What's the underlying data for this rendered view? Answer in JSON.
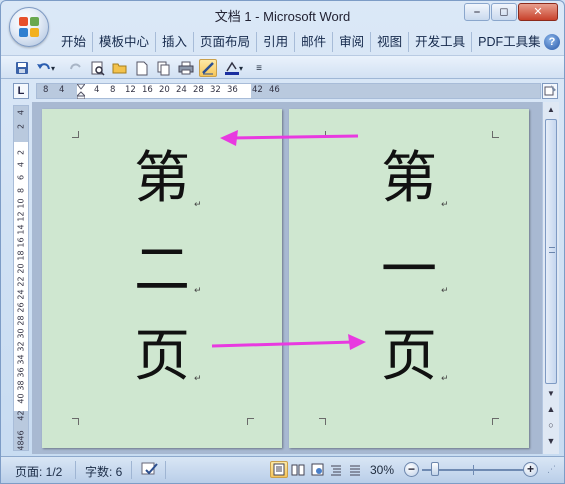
{
  "window": {
    "title": "文档 1 - Microsoft Word",
    "minimize": "⎯",
    "maximize": "◻",
    "close": "✕"
  },
  "ribbon": {
    "tabs": [
      "开始",
      "模板中心",
      "插入",
      "页面布局",
      "引用",
      "邮件",
      "审阅",
      "视图",
      "开发工具",
      "PDF工具集"
    ],
    "help": "?"
  },
  "quick_access": {
    "buttons": [
      "save-icon",
      "undo-icon",
      "redo-icon",
      "print-preview-icon",
      "open-icon",
      "new-icon",
      "copy-icon",
      "print-icon",
      "draw-icon",
      "font-color-icon",
      "customize-icon"
    ]
  },
  "ruler": {
    "corner_label": "L",
    "h_ticks": [
      "8",
      "4",
      "4",
      "8",
      "12",
      "16",
      "20",
      "24",
      "28",
      "32",
      "36",
      "42",
      "46"
    ],
    "v_ticks": [
      "4",
      "2",
      "2",
      "4",
      "6",
      "8",
      "10",
      "12",
      "14",
      "16",
      "18",
      "20",
      "22",
      "24",
      "26",
      "28",
      "30",
      "32",
      "34",
      "36",
      "38",
      "40",
      "42",
      "46",
      "48"
    ]
  },
  "document": {
    "left_page": {
      "chars": [
        "第",
        "二",
        "页"
      ]
    },
    "right_page": {
      "chars": [
        "第",
        "一",
        "页"
      ]
    },
    "paragraph_mark": "↵",
    "arrow_color": "#e83ae0",
    "page_color": "#cfe7d0"
  },
  "statusbar": {
    "page": "页面: 1/2",
    "words": "字数: 6",
    "zoom": "30%",
    "zoom_level_fraction": 0.3,
    "minus": "−",
    "plus": "+"
  }
}
